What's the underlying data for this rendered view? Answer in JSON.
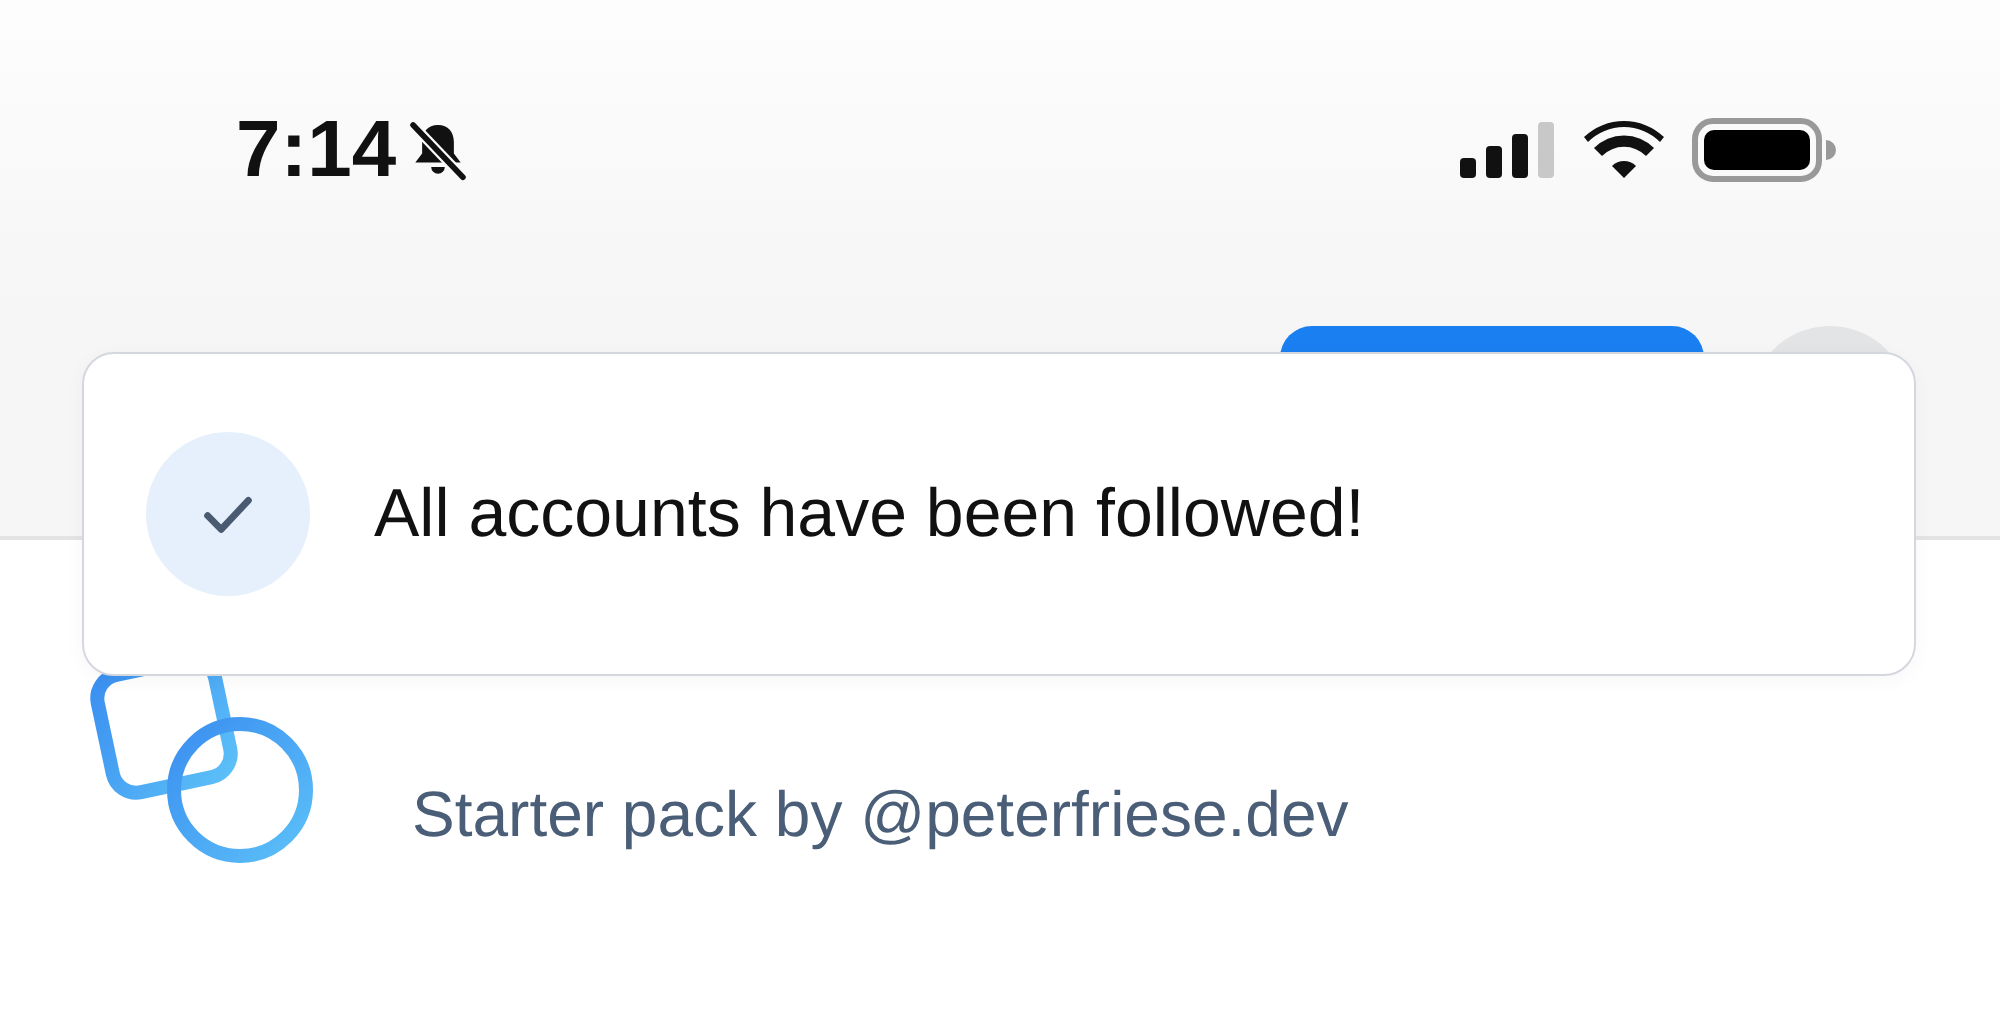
{
  "status_bar": {
    "time": "7:14"
  },
  "toast": {
    "message": "All accounts have been followed!"
  },
  "pack": {
    "subtitle": "Starter pack by @peterfriese.dev"
  }
}
